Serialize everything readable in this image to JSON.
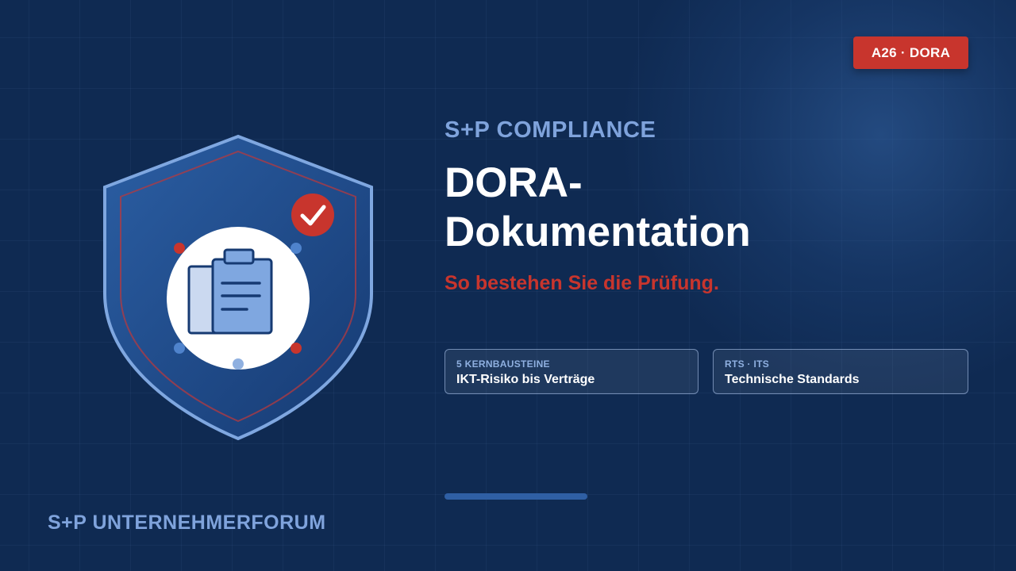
{
  "badge": {
    "label": "A26 · DORA"
  },
  "hero": {
    "eyebrow": "S+P COMPLIANCE",
    "title_line1": "DORA-",
    "title_line2": "Dokumentation",
    "subtitle": "So bestehen Sie die Prüfung."
  },
  "cards": [
    {
      "label": "5 KERNBAUSTEINE",
      "text": "IKT-Risiko bis Verträge"
    },
    {
      "label": "RTS · ITS",
      "text": "Technische Standards"
    }
  ],
  "footer": {
    "brand": "S+P UNTERNEHMERFORUM"
  },
  "illustration": {
    "icons": [
      "shield-icon",
      "clipboard-icon",
      "check-icon"
    ]
  },
  "colors": {
    "background": "#0f2a52",
    "accent_red": "#c8352d",
    "accent_blue": "#7fa3dc",
    "shield_fill": "#23508f",
    "text_white": "#ffffff"
  }
}
